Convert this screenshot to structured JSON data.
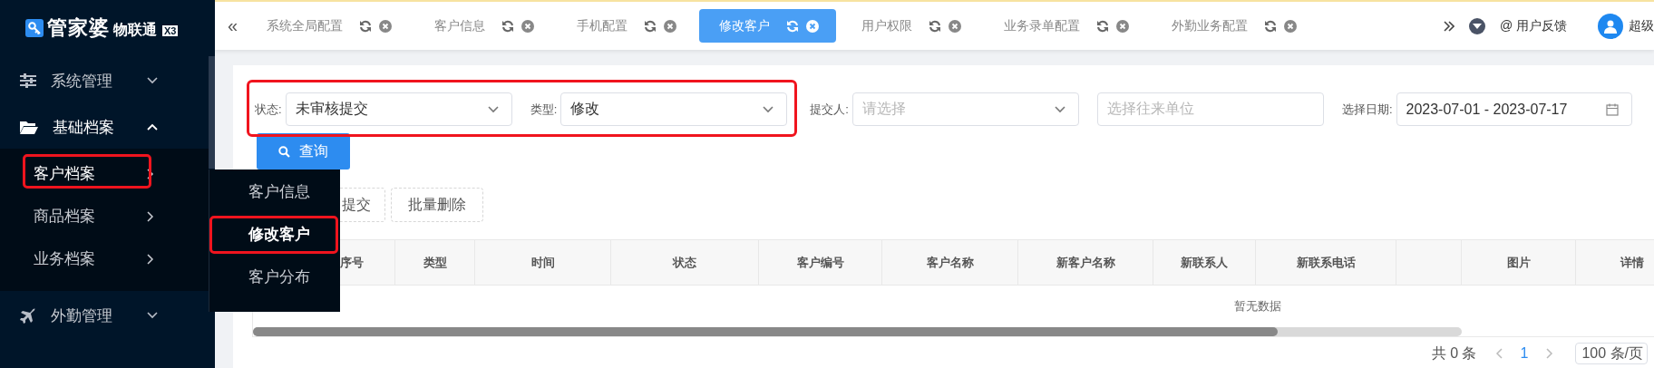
{
  "sidebar": {
    "logo": {
      "brand": "管家婆",
      "product": "物联通",
      "edition": "X3"
    },
    "items": [
      {
        "label": "系统管理",
        "expanded": false
      },
      {
        "label": "基础档案",
        "expanded": true,
        "children": [
          {
            "label": "客户档案",
            "selected": true,
            "outlined": true
          },
          {
            "label": "商品档案",
            "selected": false,
            "outlined": false
          },
          {
            "label": "业务档案",
            "selected": false,
            "outlined": false
          }
        ]
      },
      {
        "label": "外勤管理",
        "expanded": false
      }
    ]
  },
  "flyout": {
    "items": [
      {
        "label": "客户信息",
        "selected": false,
        "outlined": false
      },
      {
        "label": "修改客户",
        "selected": true,
        "outlined": true
      },
      {
        "label": "客户分布",
        "selected": false,
        "outlined": false
      }
    ]
  },
  "tabs": [
    {
      "label": "系统全局配置",
      "selected": false
    },
    {
      "label": "客户信息",
      "selected": false
    },
    {
      "label": "手机配置",
      "selected": false
    },
    {
      "label": "修改客户",
      "selected": true
    },
    {
      "label": "用户权限",
      "selected": false
    },
    {
      "label": "业务录单配置",
      "selected": false
    },
    {
      "label": "外勤业务配置",
      "selected": false
    }
  ],
  "header": {
    "collapse": "«",
    "feedback": "@ 用户反馈",
    "user": "超级"
  },
  "filters": [
    {
      "kind": "select",
      "label": "状态:",
      "value": "未审核提交",
      "outlined": true
    },
    {
      "kind": "select",
      "label": "类型:",
      "value": "修改",
      "outlined": true
    },
    {
      "kind": "select",
      "label": "提交人:",
      "placeholder": "请选择",
      "outlined": false
    },
    {
      "kind": "input",
      "placeholder": "选择往来单位",
      "outlined": false
    },
    {
      "kind": "date",
      "label": "选择日期:",
      "value": "2023-07-01 - 2023-07-17",
      "outlined": false
    }
  ],
  "search_button": "查询",
  "actions": [
    "提交",
    "批量删除"
  ],
  "table": {
    "columns": [
      "序号",
      "类型",
      "时间",
      "状态",
      "客户编号",
      "客户名称",
      "新客户名称",
      "新联系人",
      "新联系电话",
      "图片",
      "详情"
    ],
    "empty_text": "暂无数据"
  },
  "pager": {
    "total": "共 0 条",
    "page": "1",
    "page_size": "100 条/页"
  }
}
